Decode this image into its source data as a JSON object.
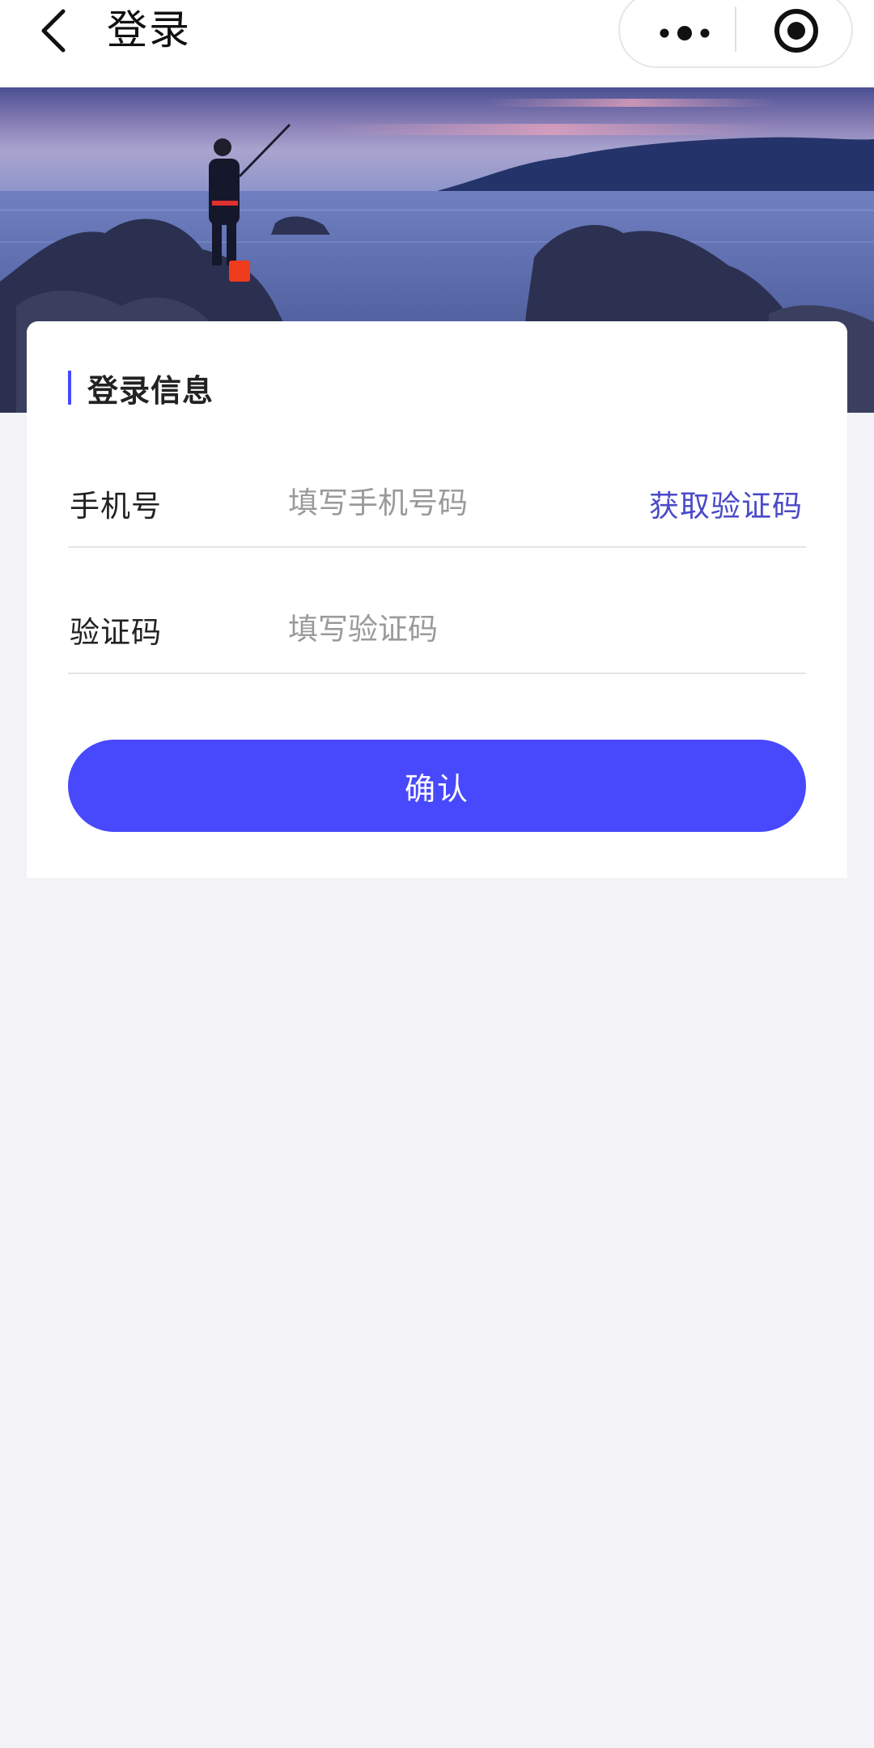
{
  "navbar": {
    "title": "登录",
    "back_icon": "chevron-left-icon",
    "more_icon": "more-dots-icon",
    "target_icon": "target-circle-icon"
  },
  "section": {
    "title": "登录信息"
  },
  "form": {
    "phone_label": "手机号",
    "phone_placeholder": "填写手机号码",
    "phone_value": "",
    "get_code_label": "获取验证码",
    "code_label": "验证码",
    "code_placeholder": "填写验证码",
    "code_value": ""
  },
  "confirm_label": "确认",
  "colors": {
    "accent": "#4848fc",
    "link": "#4a4ac8",
    "background": "#f2f2f7"
  }
}
